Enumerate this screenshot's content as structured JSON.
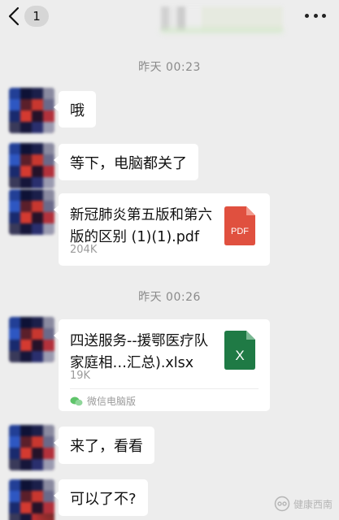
{
  "header": {
    "back_count": "1",
    "more_icon": "more-dots-icon"
  },
  "messages": {
    "time1": "昨天 00:23",
    "msg1": "哦",
    "msg2": "等下，电脑都关了",
    "file1": {
      "name": "新冠肺炎第五版和第六版的区别 (1)(1).pdf",
      "size": "204K",
      "icon_label": "PDF",
      "icon_color": "#e0503f"
    },
    "time2": "昨天 00:26",
    "file2": {
      "name": "四送服务--援鄂医疗队家庭相…汇总).xlsx",
      "size": "19K",
      "icon_label": "X",
      "icon_color": "#1f7a45",
      "source": "微信电脑版"
    },
    "msg3": "来了，看看",
    "msg4": "可以了不?"
  },
  "watermark": {
    "text": "健康西南"
  }
}
